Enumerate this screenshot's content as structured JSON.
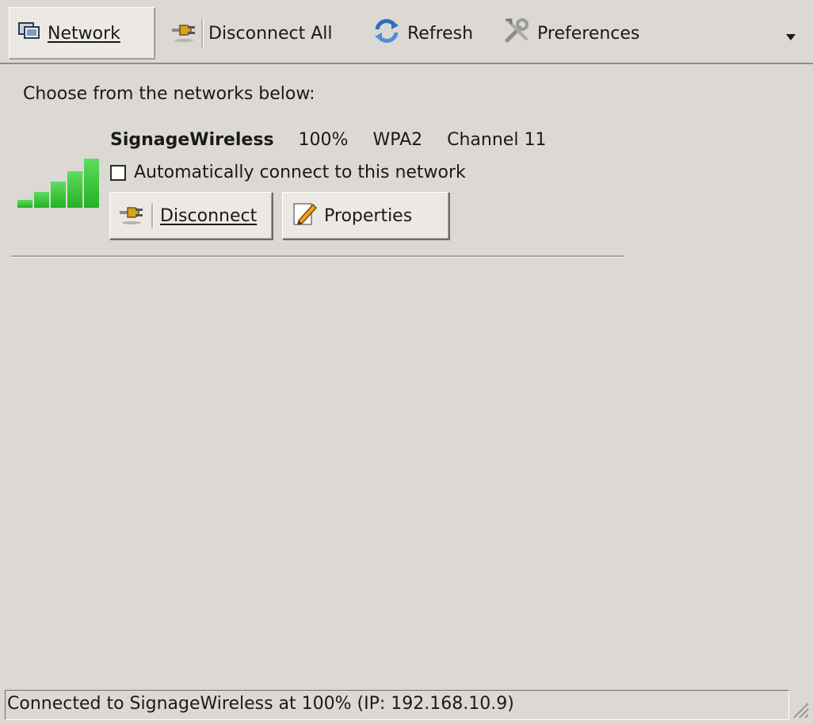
{
  "toolbar": {
    "network_label": "Network",
    "disconnect_all_label": "Disconnect All",
    "refresh_label": "Refresh",
    "preferences_label": "Preferences"
  },
  "main": {
    "intro": "Choose from the networks below:",
    "network": {
      "ssid": "SignageWireless",
      "strength": "100%",
      "security": "WPA2",
      "channel": "Channel 11",
      "signal_level": 1.0,
      "auto_connect_label": "Automatically connect to this network",
      "auto_connect_checked": false,
      "disconnect_label": "Disconnect",
      "properties_label": "Properties"
    }
  },
  "status": {
    "text": "Connected to SignageWireless at 100% (IP: 192.168.10.9)"
  },
  "colors": {
    "background": "#dcd9d4",
    "signal_green": "#23b123"
  }
}
